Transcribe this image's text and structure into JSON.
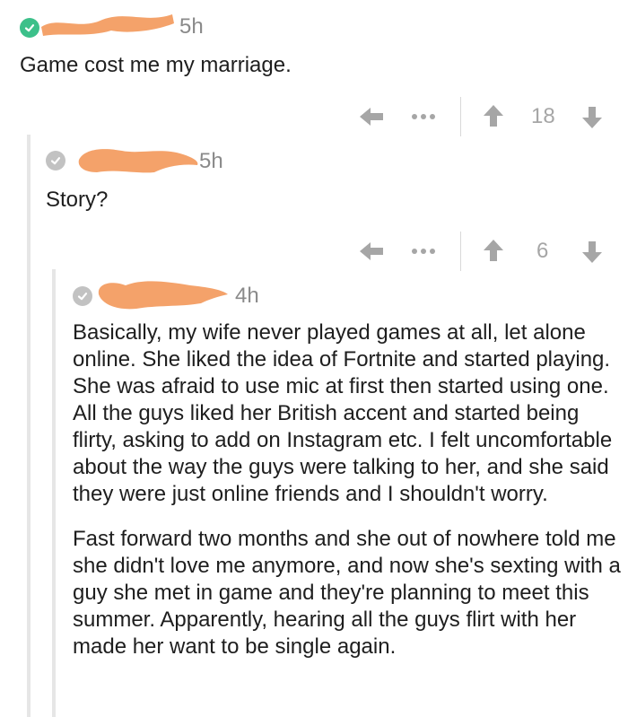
{
  "comments": [
    {
      "time": "5h",
      "paragraphs": [
        "Game cost me my marriage."
      ],
      "score": "18"
    },
    {
      "time": "5h",
      "paragraphs": [
        "Story?"
      ],
      "score": "6"
    },
    {
      "time": "4h",
      "paragraphs": [
        "Basically, my wife never played games at all, let alone online. She liked the idea of Fortnite and started playing. She was afraid to use mic at first then started using one. All the guys liked her British accent and started being flirty, asking to add on Instagram etc. I felt uncomfortable about the way the guys were talking to her, and she said they were just online friends and I shouldn't worry.",
        "Fast forward two months and she out of nowhere told me she didn't love me anymore, and now she's sexting with a guy she met in game and they're planning to meet this summer. Apparently, hearing all the guys flirt with her made her want to be single again."
      ]
    }
  ],
  "colors": {
    "accent_green": "#3cc08a",
    "avatar_grey": "#c2c2c2",
    "redaction_orange": "#f4a26a",
    "action_grey": "#a6a6a6"
  },
  "icons": {
    "reply": "reply-arrow-icon",
    "more": "more-dots-icon",
    "upvote": "upvote-arrow-icon",
    "downvote": "downvote-arrow-icon"
  }
}
